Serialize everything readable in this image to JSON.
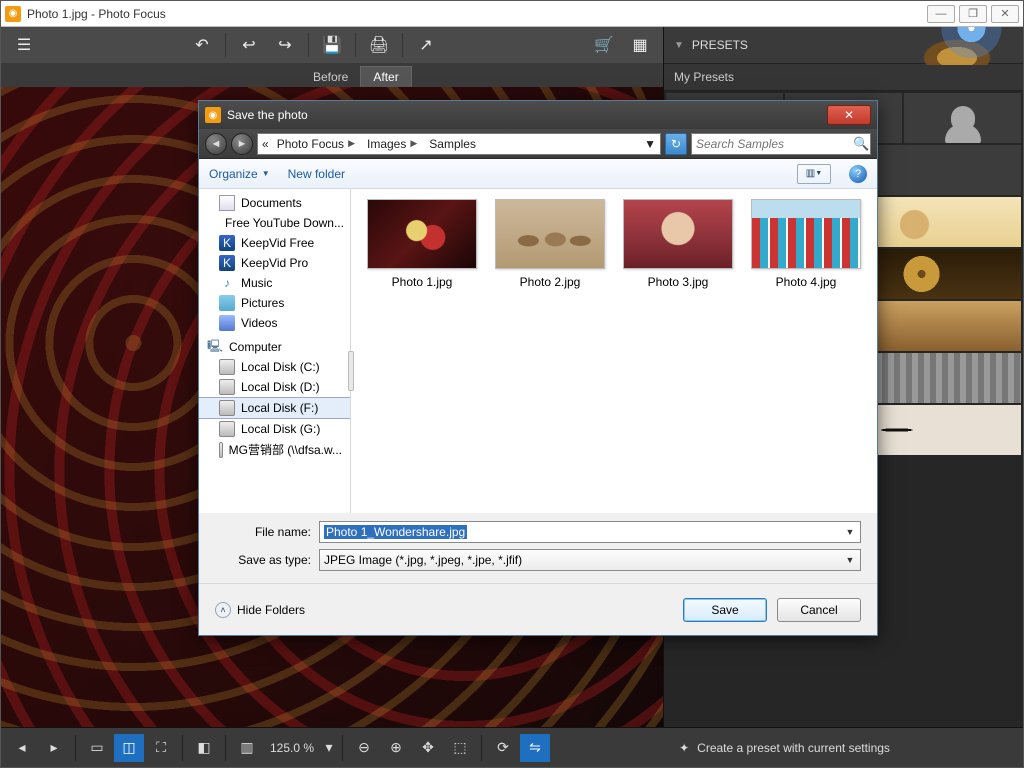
{
  "window": {
    "title": "Photo 1.jpg - Photo Focus"
  },
  "win_buttons": {
    "min": "—",
    "max": "❐",
    "close": "✕"
  },
  "top_toolbar": {
    "menu": "☰",
    "undo_all": "↶",
    "undo": "↩",
    "redo": "↪",
    "save": "💾",
    "print": "🖨",
    "share": "↗",
    "cart": "🛒",
    "grid": "▦"
  },
  "ba": {
    "before": "Before",
    "after": "After"
  },
  "presets": {
    "header": "PRESETS",
    "my_presets": "My Presets"
  },
  "bottom": {
    "prev": "◂",
    "next": "▸",
    "fit": "⛶",
    "split": "◫",
    "single": "▭",
    "compare": "◧",
    "layout": "▥",
    "zoom_label": "125.0 %",
    "zoom_out": "⊖",
    "zoom_in": "⊕",
    "pan": "✥",
    "region": "⬚",
    "rotate": "⟳",
    "flip": "⇋",
    "create_preset_icon": "✦",
    "create_preset": "Create a preset with current settings"
  },
  "dialog": {
    "title": "Save the photo",
    "back": "◄",
    "fwd": "►",
    "breadcrumb_icon": "«",
    "breadcrumb": [
      "Photo Focus",
      "Images",
      "Samples"
    ],
    "refresh": "↻",
    "search_placeholder": "Search Samples",
    "organize": "Organize",
    "new_folder": "New folder",
    "view_icon": "▥",
    "help": "?",
    "tree": {
      "documents": "Documents",
      "fytd": "Free YouTube Down...",
      "kvf": "KeepVid Free",
      "kvp": "KeepVid Pro",
      "music": "Music",
      "pictures": "Pictures",
      "videos": "Videos",
      "computer": "Computer",
      "ldc": "Local Disk (C:)",
      "ldd": "Local Disk (D:)",
      "ldf": "Local Disk (F:)",
      "ldg": "Local Disk (G:)",
      "mg": "MG营销部 (\\\\dfsa.w..."
    },
    "files": [
      {
        "name": "Photo 1.jpg"
      },
      {
        "name": "Photo 2.jpg"
      },
      {
        "name": "Photo 3.jpg"
      },
      {
        "name": "Photo 4.jpg"
      }
    ],
    "file_name_label": "File name:",
    "file_name_value": "Photo 1_Wondershare.jpg",
    "save_as_type_label": "Save as type:",
    "save_as_type_value": "JPEG Image (*.jpg, *.jpeg, *.jpe, *.jfif)",
    "hide_folders": "Hide Folders",
    "save": "Save",
    "cancel": "Cancel"
  }
}
